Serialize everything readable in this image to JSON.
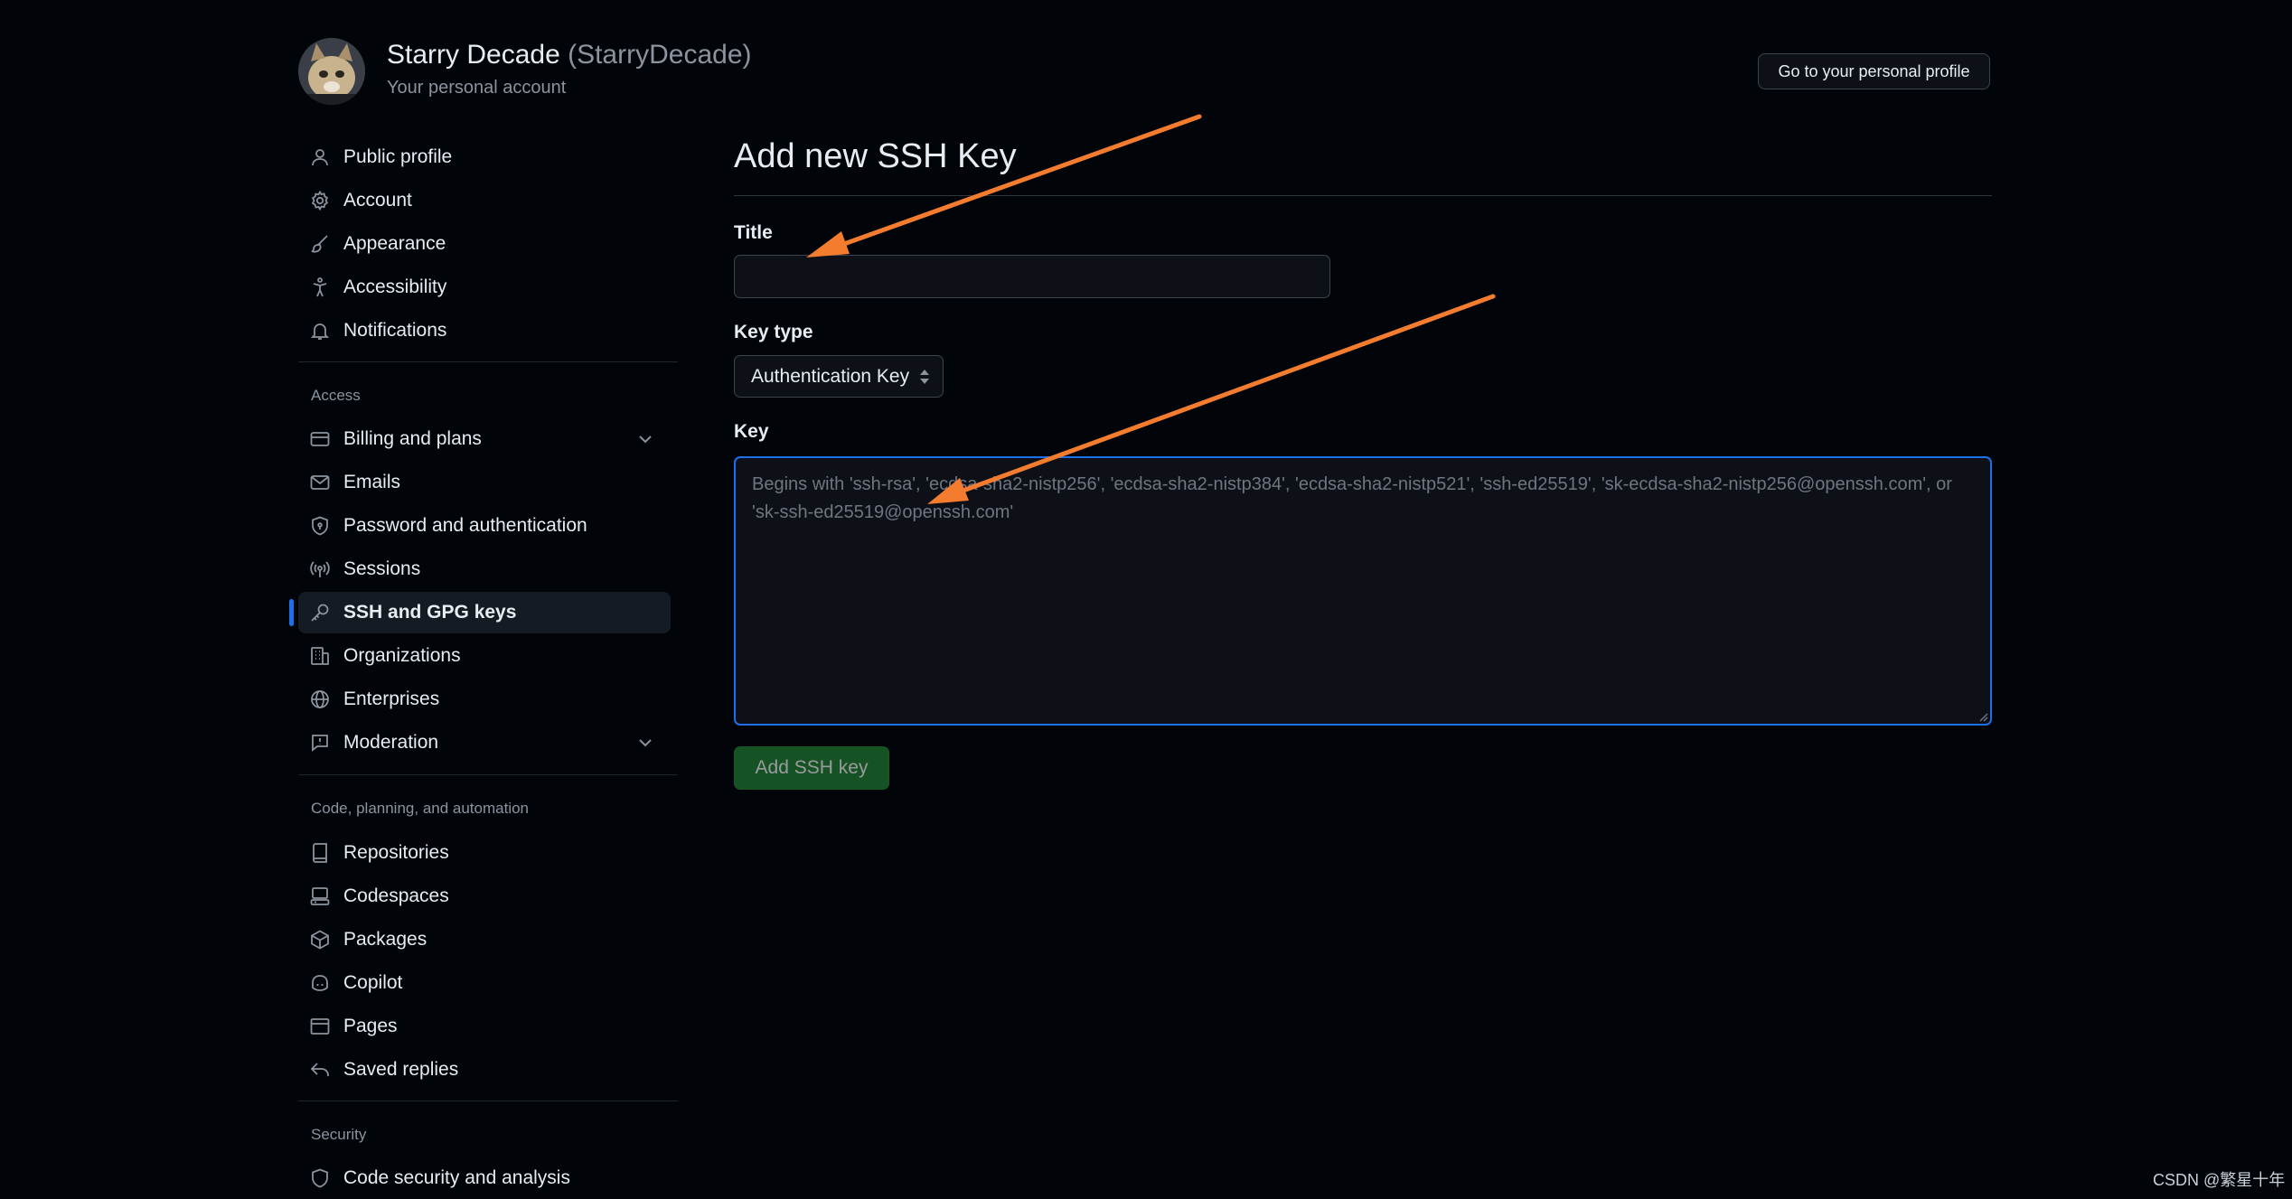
{
  "account": {
    "display_name": "Starry Decade",
    "handle": "(StarryDecade)",
    "subtitle": "Your personal account",
    "profile_button": "Go to your personal profile"
  },
  "sidebar": {
    "items_top": [
      {
        "label": "Public profile",
        "icon": "person-icon"
      },
      {
        "label": "Account",
        "icon": "gear-icon"
      },
      {
        "label": "Appearance",
        "icon": "paintbrush-icon"
      },
      {
        "label": "Accessibility",
        "icon": "accessibility-icon"
      },
      {
        "label": "Notifications",
        "icon": "bell-icon"
      }
    ],
    "section_access": "Access",
    "items_access": [
      {
        "label": "Billing and plans",
        "icon": "credit-card-icon"
      },
      {
        "label": "Emails",
        "icon": "mail-icon"
      },
      {
        "label": "Password and authentication",
        "icon": "shield-lock-icon"
      },
      {
        "label": "Sessions",
        "icon": "broadcast-icon"
      },
      {
        "label": "SSH and GPG keys",
        "icon": "key-icon"
      },
      {
        "label": "Organizations",
        "icon": "organization-icon"
      },
      {
        "label": "Enterprises",
        "icon": "globe-icon"
      },
      {
        "label": "Moderation",
        "icon": "report-icon"
      }
    ],
    "section_code": "Code, planning, and automation",
    "items_code": [
      {
        "label": "Repositories",
        "icon": "repo-icon"
      },
      {
        "label": "Codespaces",
        "icon": "codespaces-icon"
      },
      {
        "label": "Packages",
        "icon": "package-icon"
      },
      {
        "label": "Copilot",
        "icon": "copilot-icon"
      },
      {
        "label": "Pages",
        "icon": "browser-icon"
      },
      {
        "label": "Saved replies",
        "icon": "reply-icon"
      }
    ],
    "section_security": "Security",
    "items_security": [
      {
        "label": "Code security and analysis",
        "icon": "shield-icon"
      }
    ]
  },
  "form": {
    "heading": "Add new SSH Key",
    "title_label": "Title",
    "title_value": "",
    "key_type_label": "Key type",
    "key_type_selected": "Authentication Key",
    "key_label": "Key",
    "key_placeholder": "Begins with 'ssh-rsa', 'ecdsa-sha2-nistp256', 'ecdsa-sha2-nistp384', 'ecdsa-sha2-nistp521', 'ssh-ed25519', 'sk-ecdsa-sha2-nistp256@openssh.com', or 'sk-ssh-ed25519@openssh.com'",
    "submit_label": "Add SSH key"
  },
  "watermark": "CSDN @繁星十年",
  "colors": {
    "background": "#010409",
    "accent_blue": "#1f6feb",
    "button_green": "#238636",
    "annotation_arrow": "#f47c2f"
  }
}
